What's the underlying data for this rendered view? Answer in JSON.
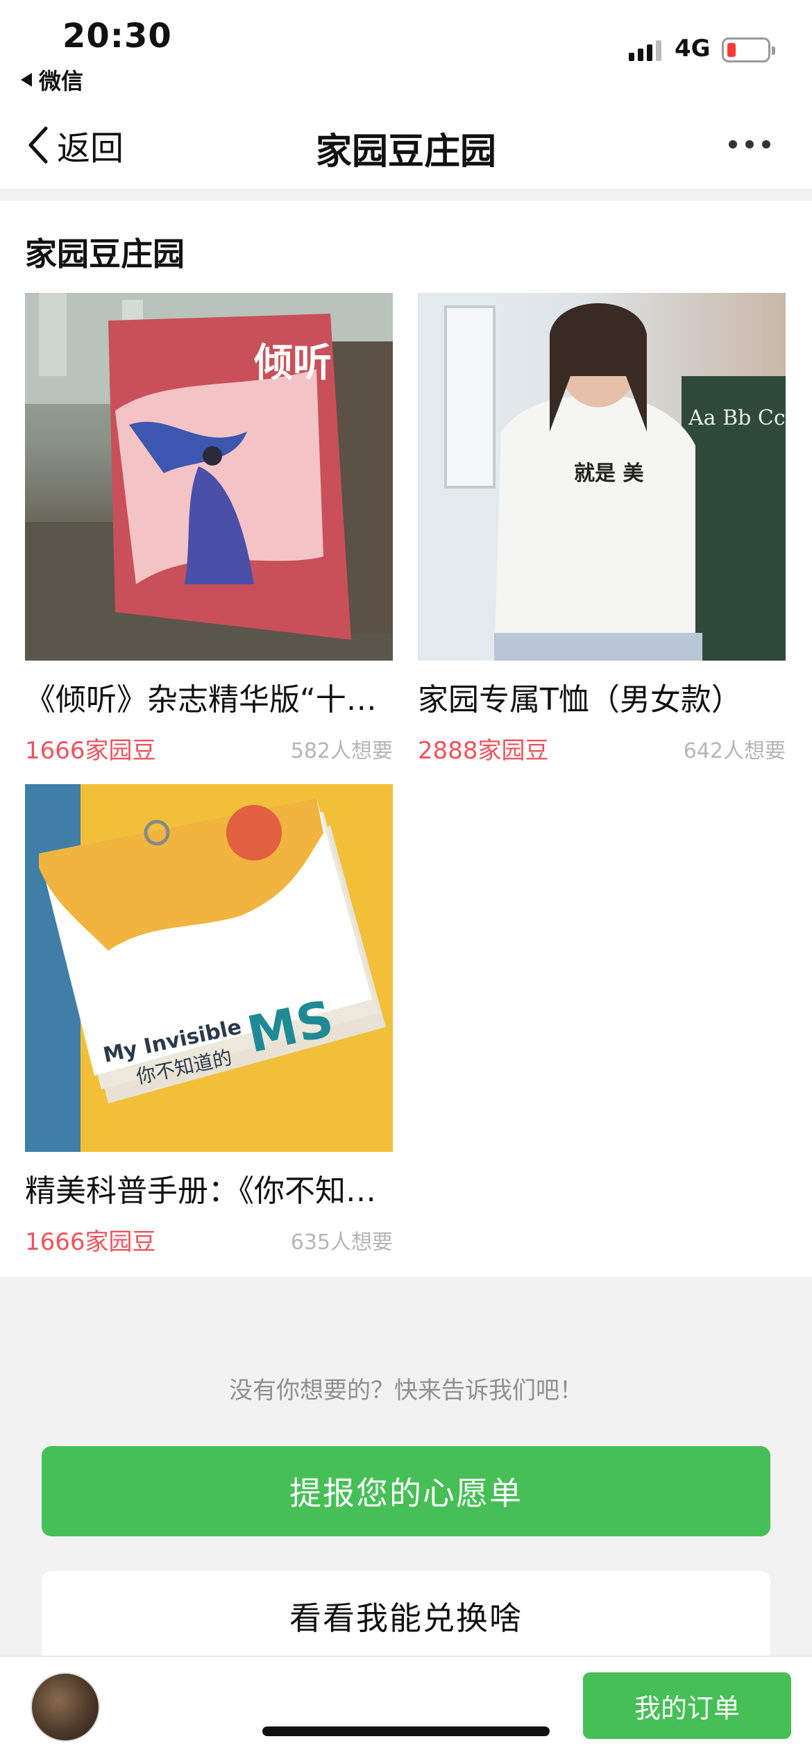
{
  "status_bar": {
    "time": "20:30",
    "back_app": "微信",
    "network": "4G"
  },
  "nav": {
    "back_label": "返回",
    "title": "家园豆庄园"
  },
  "section": {
    "title": "家园豆庄园"
  },
  "products": [
    {
      "name": "《倾听》杂志精华版“十年精选”",
      "price": "1666家园豆",
      "wants": "582人想要",
      "cover_text": "倾听"
    },
    {
      "name": "家园专属T恤（男女款）",
      "price": "2888家园豆",
      "wants": "642人想要",
      "shirt_text": "就是 美",
      "board_text": "Aa Bb Cc Ee Ff Gg Ii Jj Kk Mm Nn Oo Qq Rr Ss Vv Ww Xx"
    },
    {
      "name": "精美科普手册：《你不知道的MS》",
      "price": "1666家园豆",
      "wants": "635人想要",
      "card_line1": "My Invisible",
      "card_line2": "你不知道的",
      "card_big": "MS"
    }
  ],
  "hint": "没有你想要的？快来告诉我们吧！",
  "buttons": {
    "wishlist": "提报您的心愿单",
    "browse": "看看我能兑换啥",
    "orders": "我的订单"
  },
  "colors": {
    "accent_green": "#46bf56",
    "price_red": "#f0525b"
  }
}
